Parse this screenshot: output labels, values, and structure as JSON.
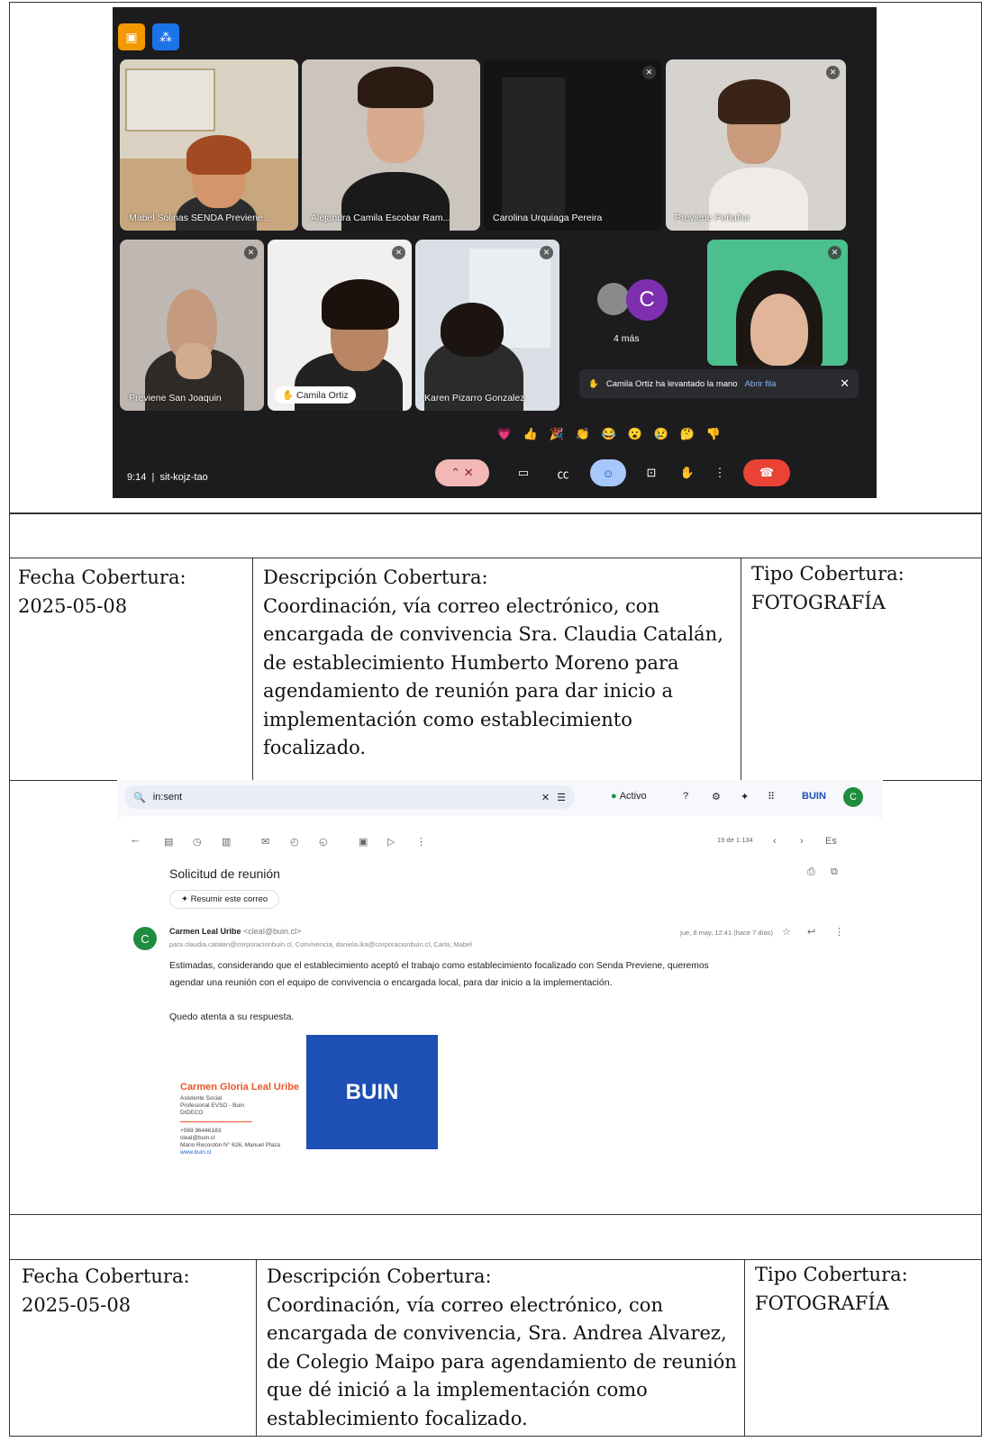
{
  "meet": {
    "participants": [
      {
        "name": "Mabel Solinas SENDA Previene..."
      },
      {
        "name": "Alejandra Camila Escobar Ram..."
      },
      {
        "name": "Carolina Urquiaga Pereira"
      },
      {
        "name": "Previene Peñaflor"
      },
      {
        "name": "Previene San Joaquin"
      },
      {
        "name": "Camila Ortiz"
      },
      {
        "name": "Karen Pizarro Gonzalez"
      }
    ],
    "avatar_letter": "C",
    "more_label": "4 más",
    "notification": {
      "text": "Camila Ortiz ha levantado la mano",
      "link": "Abrir fila"
    },
    "reactions": [
      "💗",
      "👍",
      "🎉",
      "👏",
      "😂",
      "😮",
      "😢",
      "🤔",
      "👎"
    ],
    "time": "9:14",
    "meeting_code": "sit-kojz-tao",
    "icons": {
      "close": "✕",
      "hand": "✋",
      "mic_off": "🎙",
      "more": "⋮",
      "end_call": "☎"
    }
  },
  "rows": [
    {
      "fecha_label": "Fecha Cobertura:",
      "fecha": "2025-05-08",
      "desc_label": "Descripción Cobertura:",
      "desc_lines": [
        "Coordinación, vía correo electrónico, con",
        "encargada de convivencia Sra. Claudia Catalán,",
        "de establecimiento Humberto Moreno para",
        "agendamiento de reunión para dar inicio a",
        "implementación como establecimiento",
        "focalizado."
      ],
      "tipo_label": "Tipo Cobertura:",
      "tipo": "FOTOGRAFÍA"
    },
    {
      "fecha_label": "Fecha Cobertura:",
      "fecha": "2025-05-08",
      "desc_label": "Descripción Cobertura:",
      "desc_lines": [
        "Coordinación, vía correo electrónico, con",
        "encargada de convivencia, Sra. Andrea Alvarez,",
        "de Colegio Maipo para agendamiento de reunión",
        "que dé inició a la implementación como",
        "establecimiento focalizado."
      ],
      "tipo_label": "Tipo Cobertura:",
      "tipo": "FOTOGRAFÍA"
    }
  ],
  "email": {
    "search_query": "in:sent",
    "status": "Activo",
    "brand": "BUIN",
    "account_letter": "C",
    "pager": "19 de 1.134",
    "lang": "Es",
    "subject": "Solicitud de reunión",
    "summarize_label": "Resumir este correo",
    "sender_name": "Carmen Leal Uribe",
    "sender_email": "<cleal@buin.cl>",
    "recipients": "para claudia.catalan@corporacionbuin.cl, Convivencia, daniela.ika@corporacionbuin.cl, Carla, Mabel",
    "date": "jue, 8 may, 12:41 (hace 7 días)",
    "body_lines": [
      "Estimadas, considerando que el establecimiento aceptó el trabajo como establecimiento focalizado con Senda Previene, queremos",
      "agendar una reunión con el equipo de convivencia o encargada local, para dar inicio a la implementación."
    ],
    "closing": "Quedo atenta a su respuesta.",
    "signature": {
      "name": "Carmen Gloria Leal Uribe",
      "role": "Asistente Social",
      "org": "Profesional EVSO - Buin",
      "dept": "DIDECO",
      "phone": "+569 96446183",
      "email": "cleal@buin.cl",
      "address": "Mario Recordón N° 626, Manuel Plaza",
      "web": "www.buin.cl",
      "logo_text": "BUIN"
    },
    "icons": {
      "search": "🔍",
      "close": "✕",
      "help": "?",
      "settings": "⚙",
      "sparkle": "✦",
      "apps": "⠿",
      "back": "←",
      "print": "⎙",
      "open": "⧉",
      "star": "☆",
      "reply": "↩",
      "more": "⋮"
    }
  }
}
